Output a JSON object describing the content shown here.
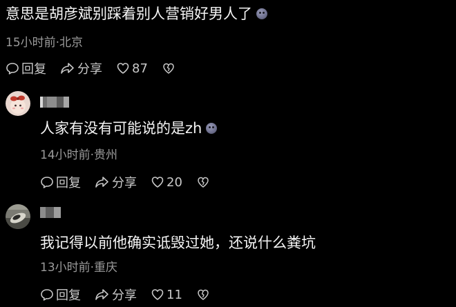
{
  "comments": [
    {
      "text": "意思是胡彦斌别踩着别人营销好男人了",
      "meta": "15小时前·北京",
      "reply_label": "回复",
      "share_label": "分享",
      "likes": "87"
    },
    {
      "text": "人家有没有可能说的是zh",
      "meta": "14小时前·贵州",
      "reply_label": "回复",
      "share_label": "分享",
      "likes": "20"
    },
    {
      "text": "我记得以前他确实诋毁过她，还说什么粪坑",
      "meta": "13小时前·重庆",
      "reply_label": "回复",
      "share_label": "分享",
      "likes": "11"
    }
  ],
  "icons": {
    "emoji": "sticker-emoji-icon",
    "reply": "speech-bubble-icon",
    "share": "share-arrow-icon",
    "like": "heart-icon",
    "dislike": "broken-heart-icon"
  },
  "colors": {
    "background": "#000000",
    "text": "#f5f5f5",
    "meta": "#9b9b9b",
    "action": "#c9c9c9"
  }
}
